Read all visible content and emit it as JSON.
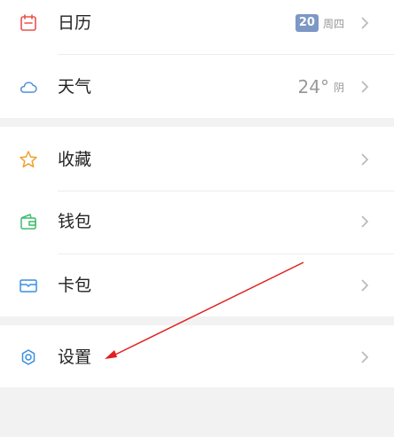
{
  "groups": [
    {
      "items": [
        {
          "label": "日历",
          "icon": "calendar-icon",
          "date": "20",
          "weekday": "周四"
        },
        {
          "label": "天气",
          "icon": "cloud-icon",
          "temp": "24°",
          "condition": "阴"
        }
      ]
    },
    {
      "items": [
        {
          "label": "收藏",
          "icon": "star-icon"
        },
        {
          "label": "钱包",
          "icon": "wallet-icon"
        },
        {
          "label": "卡包",
          "icon": "card-icon"
        }
      ]
    },
    {
      "items": [
        {
          "label": "设置",
          "icon": "settings-icon"
        }
      ]
    }
  ],
  "colors": {
    "calendar": "#e8534a",
    "cloud": "#4f8fd8",
    "star": "#f0a030",
    "wallet": "#3dbb6e",
    "card": "#3a8ee0",
    "settings": "#3a8ee0",
    "annotation_arrow": "#e02020"
  }
}
